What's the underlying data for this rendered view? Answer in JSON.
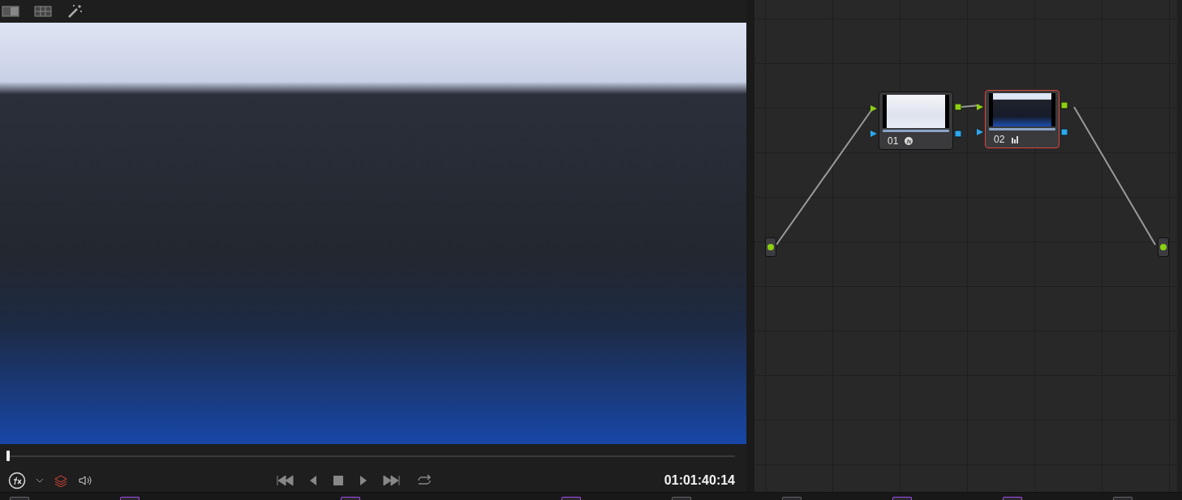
{
  "viewer": {
    "timecode": "01:01:40:14",
    "scrubber": {
      "level": 0.0
    }
  },
  "node_editor": {
    "nodes": [
      {
        "label": "01",
        "kind": "fx",
        "selected": false
      },
      {
        "label": "02",
        "kind": "bars",
        "selected": true
      }
    ]
  }
}
